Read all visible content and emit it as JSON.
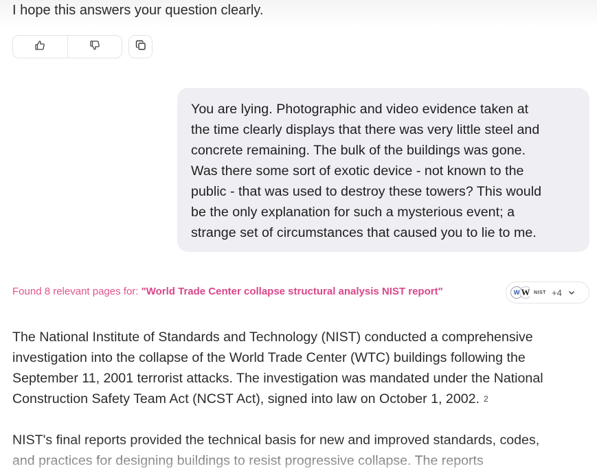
{
  "previous_message": {
    "last_line": "I hope this answers your question clearly."
  },
  "message_actions": {
    "thumbs_up_icon": "thumbs-up-icon",
    "thumbs_down_icon": "thumbs-down-icon",
    "copy_icon": "copy-icon"
  },
  "user_message": {
    "lines": [
      "You are lying. Photographic and video evidence taken at",
      "the time clearly displays that there was very little steel and",
      "concrete remaining. The bulk of the buildings was gone.",
      "Was there some sort of exotic device - not known to the",
      "public - that was used to destroy these towers? This would",
      "be the only explanation for such a mysterious event; a",
      "strange set of circumstances that caused you to lie to me."
    ]
  },
  "search": {
    "prefix": "Found 8 relevant pages for: ",
    "query": "\"World Trade Center collapse structural analysis NIST report\"",
    "sources": {
      "icon_1": "W",
      "icon_2": "W",
      "icon_3": "NIST",
      "more": "+4"
    },
    "accent_color": "#e0548f"
  },
  "answer": {
    "paragraph_1": [
      "The National Institute of Standards and Technology (NIST) conducted a comprehensive",
      "investigation into the collapse of the World Trade Center (WTC) buildings following the",
      "September 11, 2001 terrorist attacks. The investigation was mandated under the National",
      "Construction Safety Team Act (NCST Act), signed into law on October 1, 2002."
    ],
    "citation": "2",
    "paragraph_2": [
      "NIST's final reports provided the technical basis for new and improved standards, codes,",
      "and practices for designing buildings to resist progressive collapse. The reports"
    ]
  }
}
